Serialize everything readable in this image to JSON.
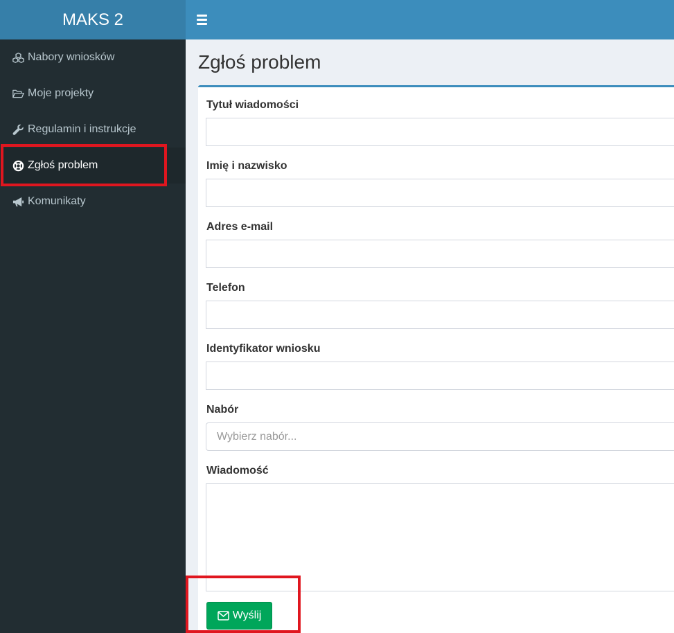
{
  "app": {
    "title": "MAKS 2"
  },
  "sidebar": {
    "items": [
      {
        "label": "Nabory wniosków",
        "icon": "cubes-icon",
        "active": false
      },
      {
        "label": "Moje projekty",
        "icon": "folder-open-icon",
        "active": false
      },
      {
        "label": "Regulamin i instrukcje",
        "icon": "wrench-icon",
        "active": false
      },
      {
        "label": "Zgłoś problem",
        "icon": "life-ring-icon",
        "active": true
      },
      {
        "label": "Komunikaty",
        "icon": "bullhorn-icon",
        "active": false
      }
    ]
  },
  "page": {
    "title": "Zgłoś problem"
  },
  "form": {
    "title": {
      "label": "Tytuł wiadomości",
      "value": ""
    },
    "name": {
      "label": "Imię i nazwisko",
      "value": ""
    },
    "email": {
      "label": "Adres e-mail",
      "value": ""
    },
    "phone": {
      "label": "Telefon",
      "value": ""
    },
    "application_id": {
      "label": "Identyfikator wniosku",
      "value": ""
    },
    "call": {
      "label": "Nabór",
      "placeholder": "Wybierz nabór..."
    },
    "message": {
      "label": "Wiadomość",
      "value": ""
    },
    "submit": {
      "label": "Wyślij",
      "icon": "envelope-icon"
    }
  },
  "colors": {
    "sidebar_bg": "#222d32",
    "brand_bg": "#367fa9",
    "topbar_bg": "#3c8dbc",
    "submit_bg": "#00a65a",
    "highlight": "#e0161f"
  }
}
